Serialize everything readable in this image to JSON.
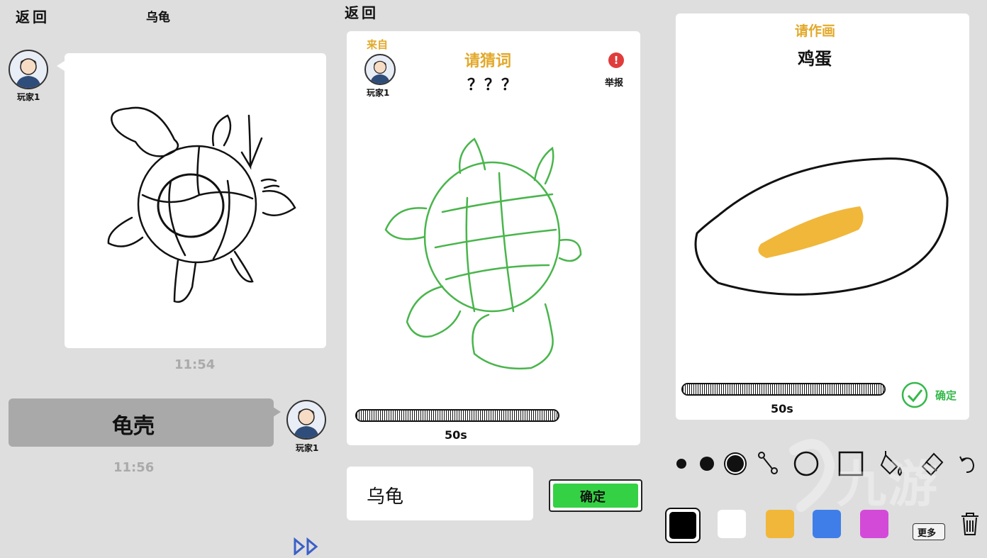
{
  "left": {
    "back_label": "返回",
    "title": "乌龟",
    "player_name": "玩家1",
    "time1": "11:54",
    "answer": "龟壳",
    "player_name2": "玩家1",
    "time2": "11:56"
  },
  "middle": {
    "back_label": "返回",
    "from_label": "来自",
    "player_name": "玩家1",
    "prompt": "请猜词",
    "hidden_word": "？？？",
    "report_label": "举报",
    "timer": "50s",
    "timer_progress": 1.0,
    "input_value": "乌龟",
    "confirm_label": "确定"
  },
  "right": {
    "prompt": "请作画",
    "word": "鸡蛋",
    "timer": "50s",
    "timer_progress": 1.0,
    "confirm_label": "确定",
    "tools": [
      "small-brush-icon",
      "medium-brush-icon",
      "large-brush-icon",
      "line-tool-icon",
      "circle-tool-icon",
      "rectangle-tool-icon",
      "fill-bucket-icon",
      "eraser-icon",
      "undo-icon"
    ],
    "colors": [
      "#000000",
      "#ffffff",
      "#f0b73a",
      "#3f7ee8",
      "#d44ad8"
    ],
    "more_label": "更多"
  },
  "watermark": "九游"
}
